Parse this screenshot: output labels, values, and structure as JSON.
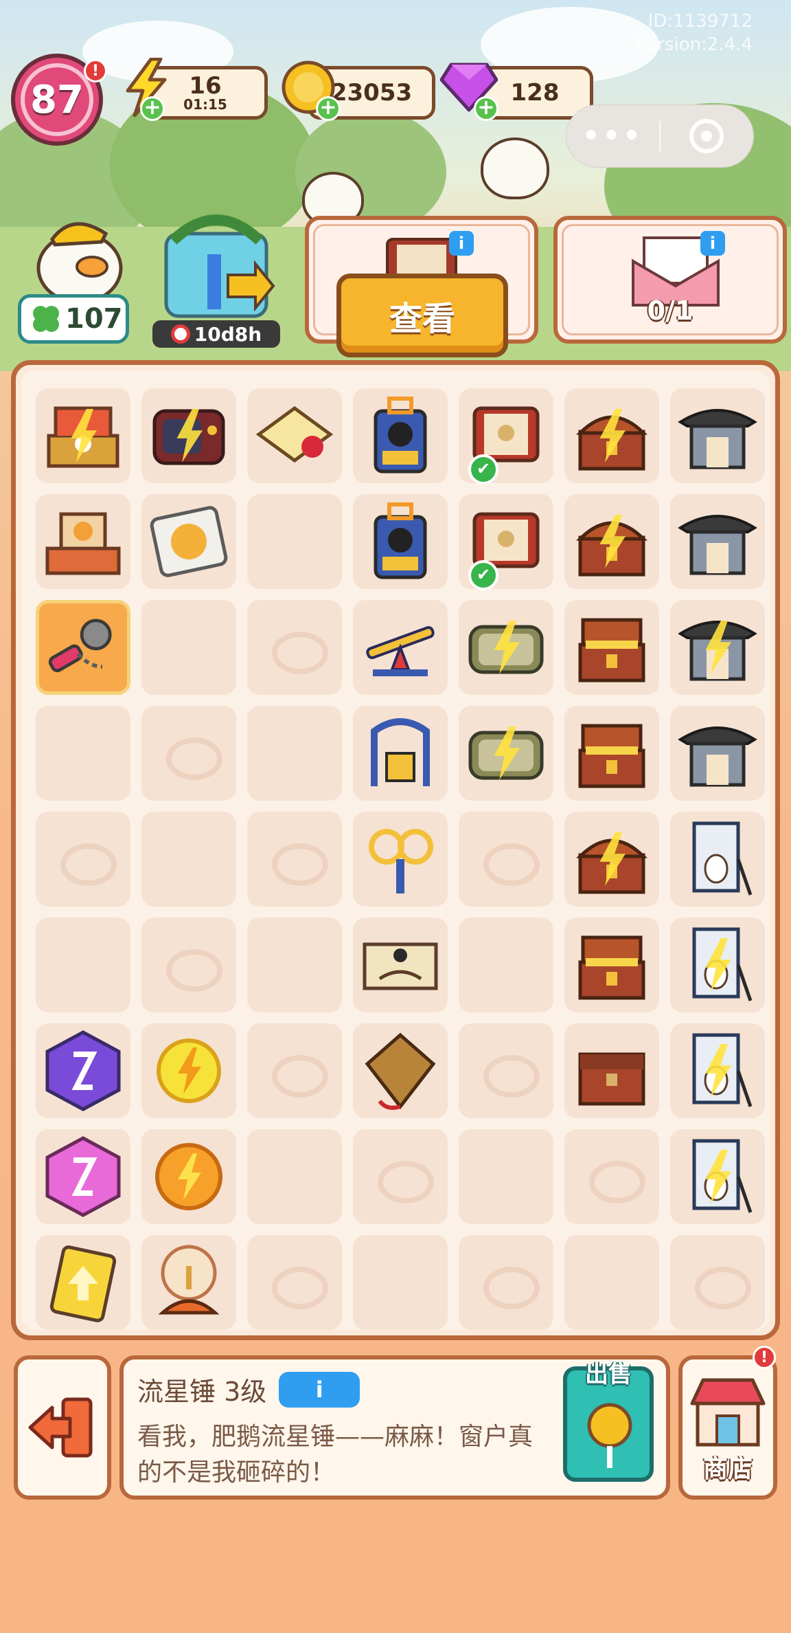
{
  "header": {
    "user_id": "ID:1139712",
    "version": "Version:2.4.4",
    "level": "87",
    "level_alert": "!",
    "energy": {
      "value": "16",
      "timer": "01:15"
    },
    "coins": "23053",
    "gems": "128",
    "plus": "+"
  },
  "mini_program_capsule": {
    "more": "•••"
  },
  "side": {
    "star_count": "107",
    "event_timer": "10d8h"
  },
  "cards": {
    "view_button": "查看",
    "mail_progress": "0/1",
    "info": "i"
  },
  "board": {
    "columns": 7,
    "rows": 9,
    "selected_cell": [
      2,
      0
    ],
    "cells": [
      [
        "stage-gold",
        "tv",
        "letter",
        "speaker",
        "scroll-check",
        "chest-bolt",
        "shrine"
      ],
      [
        "stage",
        "record",
        "blank",
        "speaker",
        "scroll-check",
        "chest-bolt",
        "shrine"
      ],
      [
        "meteor-hammer",
        "blank",
        "empty",
        "seesaw",
        "case-bolt",
        "chest-open",
        "shrine-bolt"
      ],
      [
        "blank",
        "empty",
        "blank",
        "swing",
        "case-bolt",
        "chest-open",
        "shrine"
      ],
      [
        "empty",
        "blank",
        "empty",
        "wheels",
        "empty",
        "chest-bolt",
        "painting"
      ],
      [
        "blank",
        "empty",
        "blank",
        "scroll-ink",
        "blank",
        "chest-open",
        "painting-bolt"
      ],
      [
        "hourglass-purple",
        "energy-coin",
        "empty",
        "kite",
        "empty",
        "chest-closed",
        "painting-bolt"
      ],
      [
        "hourglass-pink",
        "energy-orb",
        "blank",
        "empty",
        "blank",
        "empty",
        "painting-bolt"
      ],
      [
        "upgrade-card",
        "crystal-ball",
        "empty",
        "blank",
        "empty",
        "blank",
        "empty"
      ]
    ],
    "check_mark": "✔"
  },
  "bottom": {
    "item_name": "流星锤 3级",
    "info_label": "i",
    "description": "看我，肥鹅流星锤——麻麻！窗户真的不是我砸碎的！",
    "sell_label": "出售",
    "shop_label": "商店",
    "shop_alert": "!"
  },
  "colors": {
    "frame_brown": "#b8683b",
    "accent_yellow": "#f6b52c",
    "teal": "#2fbfb3",
    "info_blue": "#2f9ef0"
  }
}
